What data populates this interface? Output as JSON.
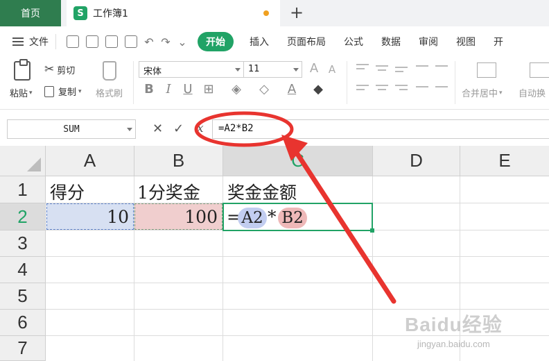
{
  "tabs": {
    "home_label": "首页",
    "doc_icon_letter": "S",
    "doc_name": "工作簿1",
    "add_symbol": "+"
  },
  "menu": {
    "file_label": "文件",
    "tabs": [
      "开始",
      "插入",
      "页面布局",
      "公式",
      "数据",
      "审阅",
      "视图",
      "开"
    ],
    "active_tab": "开始",
    "overflow_symbol": "⌄"
  },
  "ribbon": {
    "paste_label": "粘贴",
    "cut_label": "剪切",
    "copy_label": "复制",
    "format_painter_label": "格式刷",
    "font_name": "宋体",
    "font_size": "11",
    "merge_label": "合并居中",
    "wrap_label": "自动换"
  },
  "formula_bar": {
    "name_box": "SUM",
    "formula": "=A2*B2"
  },
  "sheet": {
    "columns": [
      "A",
      "B",
      "C",
      "D",
      "E"
    ],
    "selected_column": "C",
    "rows": [
      "1",
      "2",
      "3",
      "4",
      "5",
      "6",
      "7"
    ],
    "selected_row": "2",
    "cells": {
      "A1": "得分",
      "B1": "1分奖金",
      "C1": "奖金金额",
      "A2": "10",
      "B2": "100"
    },
    "formula_parts": {
      "eq": "=",
      "ref_a": "A2",
      "op": "*",
      "ref_b": "B2"
    }
  },
  "colors": {
    "brand_green": "#21a366",
    "home_tab": "#2f7d4f",
    "ref_a_fill": "#d7e0f2",
    "ref_b_fill": "#f0cece",
    "annotation_red": "#e8342f"
  },
  "watermark": {
    "brand": "Baidu经验",
    "url": "jingyan.baidu.com"
  }
}
